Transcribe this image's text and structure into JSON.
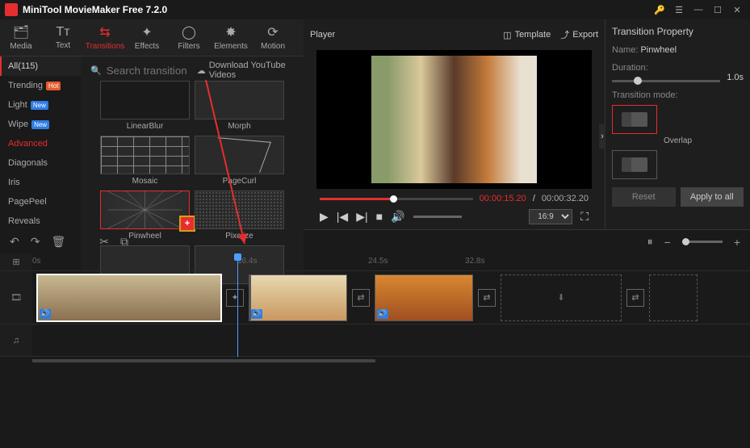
{
  "app": {
    "title": "MiniTool MovieMaker Free 7.2.0"
  },
  "toolbar": {
    "items": [
      {
        "icon": "🗂",
        "label": "Media"
      },
      {
        "icon": "T⊤",
        "label": "Text"
      },
      {
        "icon": "⇄",
        "label": "Transitions"
      },
      {
        "icon": "✦",
        "label": "Effects"
      },
      {
        "icon": "◯",
        "label": "Filters"
      },
      {
        "icon": "✱",
        "label": "Elements"
      },
      {
        "icon": "⟳",
        "label": "Motion"
      }
    ]
  },
  "sidebar": {
    "all_label": "All(115)",
    "items": [
      {
        "label": "Trending",
        "badge": "Hot",
        "badge_cls": "hot"
      },
      {
        "label": "Light",
        "badge": "New",
        "badge_cls": "new"
      },
      {
        "label": "Wipe",
        "badge": "New",
        "badge_cls": "new"
      },
      {
        "label": "Advanced"
      },
      {
        "label": "Diagonals"
      },
      {
        "label": "Iris"
      },
      {
        "label": "PagePeel"
      },
      {
        "label": "Reveals"
      }
    ]
  },
  "search": {
    "placeholder": "Search transitions",
    "download_label": "Download YouTube Videos"
  },
  "transitions": {
    "items": [
      {
        "label": "LinearBlur"
      },
      {
        "label": "Morph"
      },
      {
        "label": "Mosaic"
      },
      {
        "label": "PageCurl"
      },
      {
        "label": "Pinwheel",
        "selected": true,
        "add": true
      },
      {
        "label": "Pixelize"
      }
    ]
  },
  "player": {
    "title": "Player",
    "template_label": "Template",
    "export_label": "Export",
    "time_current": "00:00:15.20",
    "time_sep": " / ",
    "time_total": "00:00:32.20",
    "aspect": "16:9"
  },
  "props": {
    "panel_title": "Transition Property",
    "name_label": "Name:",
    "name_value": "Pinwheel",
    "duration_label": "Duration:",
    "duration_value": "1.0s",
    "mode_label": "Transition mode:",
    "mode_overlap": "Overlap",
    "reset": "Reset",
    "apply_all": "Apply to all"
  },
  "ruler": {
    "marks": [
      {
        "pos": "0px",
        "label": "0s"
      },
      {
        "pos": "254px",
        "label": "16.4s"
      },
      {
        "pos": "416px",
        "label": "24.5s"
      },
      {
        "pos": "536px",
        "label": "32.8s"
      }
    ]
  }
}
